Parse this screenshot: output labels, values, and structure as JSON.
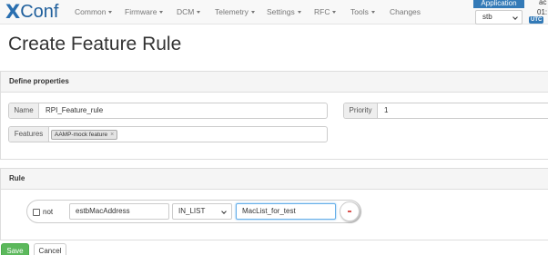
{
  "app": {
    "logo_x": "X",
    "logo_text": "Conf"
  },
  "nav": {
    "items": [
      {
        "label": "Common",
        "dropdown": true
      },
      {
        "label": "Firmware",
        "dropdown": true
      },
      {
        "label": "DCM",
        "dropdown": true
      },
      {
        "label": "Telemetry",
        "dropdown": true
      },
      {
        "label": "Settings",
        "dropdown": true
      },
      {
        "label": "RFC",
        "dropdown": true
      },
      {
        "label": "Tools",
        "dropdown": true
      },
      {
        "label": "Changes",
        "dropdown": false
      }
    ]
  },
  "application_selector": {
    "label": "Application",
    "selected": "stb"
  },
  "user": {
    "line1": "ac",
    "line2": "01:",
    "timezone_badge": "UTC"
  },
  "page": {
    "title": "Create Feature Rule"
  },
  "define_properties": {
    "heading": "Define properties",
    "name_label": "Name",
    "name_value": "RPI_Feature_rule",
    "priority_label": "Priority",
    "priority_value": "1",
    "features_label": "Features",
    "features": [
      {
        "label": "AAMP-mock feature",
        "remove": "×"
      }
    ]
  },
  "rule": {
    "heading": "Rule",
    "not_label": "not",
    "field": "estbMacAddress",
    "operation": "IN_LIST",
    "value": "MacList_for_test"
  },
  "actions": {
    "save": "Save",
    "cancel": "Cancel"
  },
  "colors": {
    "brand": "#337ab7",
    "save": "#5cb85c",
    "remove": "#d9534f"
  }
}
